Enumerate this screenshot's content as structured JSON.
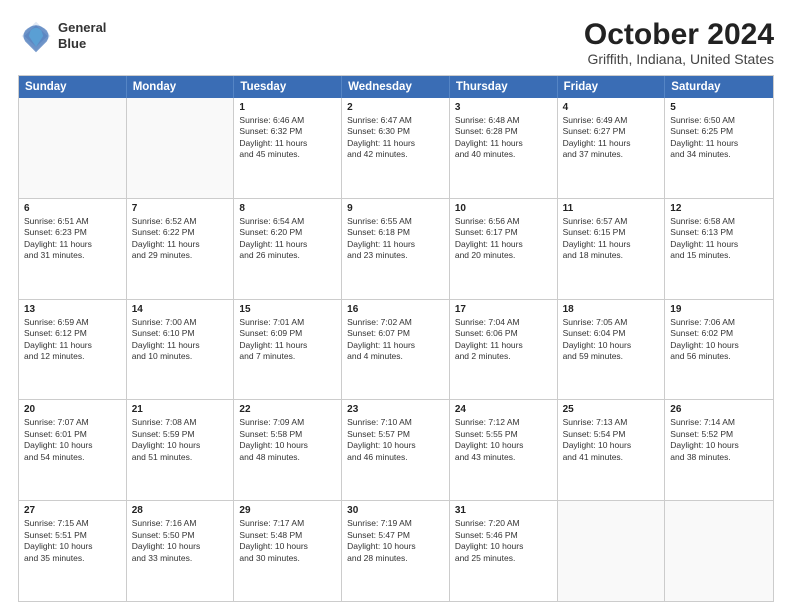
{
  "header": {
    "logo": {
      "line1": "General",
      "line2": "Blue"
    },
    "title": "October 2024",
    "subtitle": "Griffith, Indiana, United States"
  },
  "weekdays": [
    "Sunday",
    "Monday",
    "Tuesday",
    "Wednesday",
    "Thursday",
    "Friday",
    "Saturday"
  ],
  "rows": [
    [
      {
        "day": "",
        "empty": true
      },
      {
        "day": "",
        "empty": true
      },
      {
        "day": "1",
        "lines": [
          "Sunrise: 6:46 AM",
          "Sunset: 6:32 PM",
          "Daylight: 11 hours",
          "and 45 minutes."
        ]
      },
      {
        "day": "2",
        "lines": [
          "Sunrise: 6:47 AM",
          "Sunset: 6:30 PM",
          "Daylight: 11 hours",
          "and 42 minutes."
        ]
      },
      {
        "day": "3",
        "lines": [
          "Sunrise: 6:48 AM",
          "Sunset: 6:28 PM",
          "Daylight: 11 hours",
          "and 40 minutes."
        ]
      },
      {
        "day": "4",
        "lines": [
          "Sunrise: 6:49 AM",
          "Sunset: 6:27 PM",
          "Daylight: 11 hours",
          "and 37 minutes."
        ]
      },
      {
        "day": "5",
        "lines": [
          "Sunrise: 6:50 AM",
          "Sunset: 6:25 PM",
          "Daylight: 11 hours",
          "and 34 minutes."
        ]
      }
    ],
    [
      {
        "day": "6",
        "lines": [
          "Sunrise: 6:51 AM",
          "Sunset: 6:23 PM",
          "Daylight: 11 hours",
          "and 31 minutes."
        ]
      },
      {
        "day": "7",
        "lines": [
          "Sunrise: 6:52 AM",
          "Sunset: 6:22 PM",
          "Daylight: 11 hours",
          "and 29 minutes."
        ]
      },
      {
        "day": "8",
        "lines": [
          "Sunrise: 6:54 AM",
          "Sunset: 6:20 PM",
          "Daylight: 11 hours",
          "and 26 minutes."
        ]
      },
      {
        "day": "9",
        "lines": [
          "Sunrise: 6:55 AM",
          "Sunset: 6:18 PM",
          "Daylight: 11 hours",
          "and 23 minutes."
        ]
      },
      {
        "day": "10",
        "lines": [
          "Sunrise: 6:56 AM",
          "Sunset: 6:17 PM",
          "Daylight: 11 hours",
          "and 20 minutes."
        ]
      },
      {
        "day": "11",
        "lines": [
          "Sunrise: 6:57 AM",
          "Sunset: 6:15 PM",
          "Daylight: 11 hours",
          "and 18 minutes."
        ]
      },
      {
        "day": "12",
        "lines": [
          "Sunrise: 6:58 AM",
          "Sunset: 6:13 PM",
          "Daylight: 11 hours",
          "and 15 minutes."
        ]
      }
    ],
    [
      {
        "day": "13",
        "lines": [
          "Sunrise: 6:59 AM",
          "Sunset: 6:12 PM",
          "Daylight: 11 hours",
          "and 12 minutes."
        ]
      },
      {
        "day": "14",
        "lines": [
          "Sunrise: 7:00 AM",
          "Sunset: 6:10 PM",
          "Daylight: 11 hours",
          "and 10 minutes."
        ]
      },
      {
        "day": "15",
        "lines": [
          "Sunrise: 7:01 AM",
          "Sunset: 6:09 PM",
          "Daylight: 11 hours",
          "and 7 minutes."
        ]
      },
      {
        "day": "16",
        "lines": [
          "Sunrise: 7:02 AM",
          "Sunset: 6:07 PM",
          "Daylight: 11 hours",
          "and 4 minutes."
        ]
      },
      {
        "day": "17",
        "lines": [
          "Sunrise: 7:04 AM",
          "Sunset: 6:06 PM",
          "Daylight: 11 hours",
          "and 2 minutes."
        ]
      },
      {
        "day": "18",
        "lines": [
          "Sunrise: 7:05 AM",
          "Sunset: 6:04 PM",
          "Daylight: 10 hours",
          "and 59 minutes."
        ]
      },
      {
        "day": "19",
        "lines": [
          "Sunrise: 7:06 AM",
          "Sunset: 6:02 PM",
          "Daylight: 10 hours",
          "and 56 minutes."
        ]
      }
    ],
    [
      {
        "day": "20",
        "lines": [
          "Sunrise: 7:07 AM",
          "Sunset: 6:01 PM",
          "Daylight: 10 hours",
          "and 54 minutes."
        ]
      },
      {
        "day": "21",
        "lines": [
          "Sunrise: 7:08 AM",
          "Sunset: 5:59 PM",
          "Daylight: 10 hours",
          "and 51 minutes."
        ]
      },
      {
        "day": "22",
        "lines": [
          "Sunrise: 7:09 AM",
          "Sunset: 5:58 PM",
          "Daylight: 10 hours",
          "and 48 minutes."
        ]
      },
      {
        "day": "23",
        "lines": [
          "Sunrise: 7:10 AM",
          "Sunset: 5:57 PM",
          "Daylight: 10 hours",
          "and 46 minutes."
        ]
      },
      {
        "day": "24",
        "lines": [
          "Sunrise: 7:12 AM",
          "Sunset: 5:55 PM",
          "Daylight: 10 hours",
          "and 43 minutes."
        ]
      },
      {
        "day": "25",
        "lines": [
          "Sunrise: 7:13 AM",
          "Sunset: 5:54 PM",
          "Daylight: 10 hours",
          "and 41 minutes."
        ]
      },
      {
        "day": "26",
        "lines": [
          "Sunrise: 7:14 AM",
          "Sunset: 5:52 PM",
          "Daylight: 10 hours",
          "and 38 minutes."
        ]
      }
    ],
    [
      {
        "day": "27",
        "lines": [
          "Sunrise: 7:15 AM",
          "Sunset: 5:51 PM",
          "Daylight: 10 hours",
          "and 35 minutes."
        ]
      },
      {
        "day": "28",
        "lines": [
          "Sunrise: 7:16 AM",
          "Sunset: 5:50 PM",
          "Daylight: 10 hours",
          "and 33 minutes."
        ]
      },
      {
        "day": "29",
        "lines": [
          "Sunrise: 7:17 AM",
          "Sunset: 5:48 PM",
          "Daylight: 10 hours",
          "and 30 minutes."
        ]
      },
      {
        "day": "30",
        "lines": [
          "Sunrise: 7:19 AM",
          "Sunset: 5:47 PM",
          "Daylight: 10 hours",
          "and 28 minutes."
        ]
      },
      {
        "day": "31",
        "lines": [
          "Sunrise: 7:20 AM",
          "Sunset: 5:46 PM",
          "Daylight: 10 hours",
          "and 25 minutes."
        ]
      },
      {
        "day": "",
        "empty": true
      },
      {
        "day": "",
        "empty": true
      }
    ]
  ]
}
